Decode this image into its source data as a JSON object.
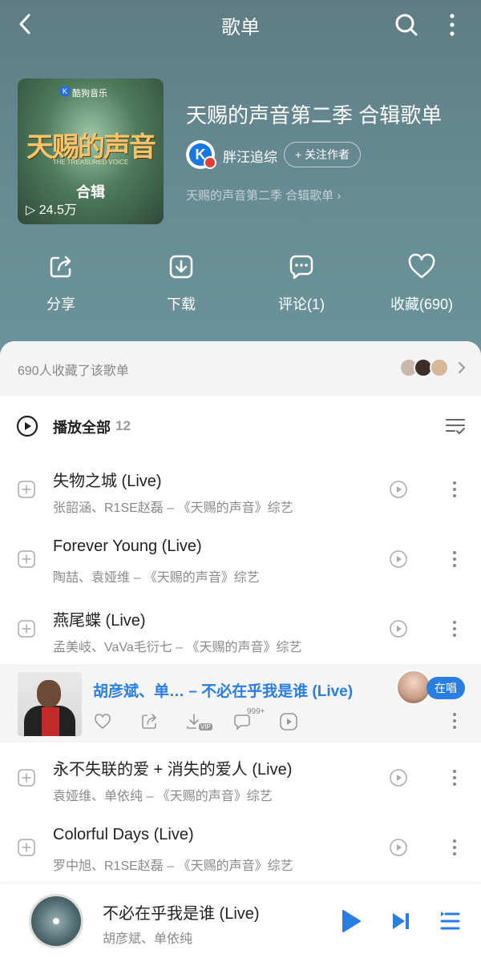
{
  "header": {
    "title": "歌单"
  },
  "cover": {
    "brand": "酷狗音乐",
    "show_title": "天赐的声音",
    "show_subtitle": "THE TREASURED VOICE",
    "album_tag": "合辑",
    "play_count": "24.5万"
  },
  "playlist": {
    "title": "天赐的声音第二季 合辑歌单",
    "author": "胖汪追综",
    "follow_label": "+ 关注作者",
    "description": "天赐的声音第二季 合辑歌单 ›"
  },
  "actions": [
    {
      "label": "分享"
    },
    {
      "label": "下载"
    },
    {
      "label": "评论(1)"
    },
    {
      "label": "收藏(690)"
    }
  ],
  "favorites": {
    "text": "690人收藏了该歌单"
  },
  "list": {
    "play_all_label": "播放全部",
    "count": "12"
  },
  "songs": [
    {
      "name": "失物之城 (Live)",
      "meta": "张韶涵、R1SE赵磊 – 《天赐的声音》综艺"
    },
    {
      "name": "Forever Young (Live)",
      "meta": "陶喆、袁娅维 – 《天赐的声音》综艺"
    },
    {
      "name": "燕尾蝶 (Live)",
      "meta": "孟美岐、VaVa毛衍七 – 《天赐的声音》综艺"
    },
    {
      "name": "永不失联的爱 + 消失的爱人 (Live)",
      "meta": "袁娅维、单依纯 – 《天赐的声音》综艺"
    },
    {
      "name": "Colorful Days (Live)",
      "meta": "罗中旭、R1SE赵磊 – 《天赐的声音》综艺"
    }
  ],
  "now_playing_row": {
    "title": "胡彦斌、单… – 不必在乎我是谁 (Live)",
    "comment_badge": "999+",
    "download_badge": "VIP",
    "singing_label": "在唱"
  },
  "player": {
    "song": "不必在乎我是谁 (Live)",
    "artist": "胡彦斌、单依纯"
  },
  "colors": {
    "accent": "#2a7de1",
    "header_bg": "#668a92"
  }
}
